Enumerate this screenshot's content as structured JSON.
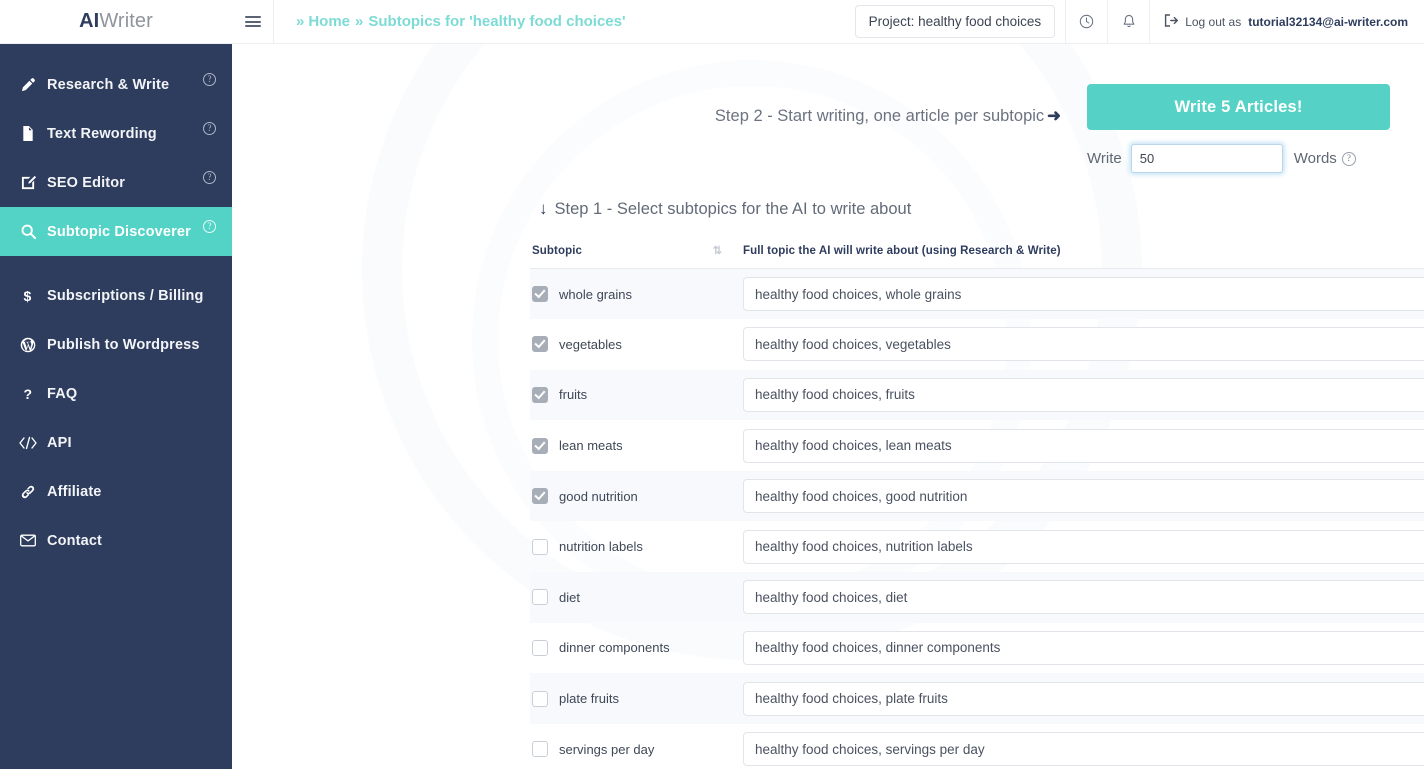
{
  "brand": {
    "bold": "AI",
    "light": "Writer"
  },
  "topbar": {
    "breadcrumb": {
      "chevron": "»",
      "home": "Home",
      "separator": "»",
      "current": "Subtopics for 'healthy food choices'"
    },
    "project_box": "Project: healthy food choices",
    "history_icon": "history-icon",
    "bell_icon": "bell-icon",
    "logout_prefix": "Log out as",
    "logout_email": "tutorial32134@ai-writer.com"
  },
  "sidebar": {
    "items": [
      {
        "label": "Research & Write",
        "icon": "pen-icon",
        "help": "?",
        "active": false
      },
      {
        "label": "Text Rewording",
        "icon": "document-icon",
        "help": "?",
        "active": false
      },
      {
        "label": "SEO Editor",
        "icon": "edit-square-icon",
        "help": "?",
        "active": false
      },
      {
        "label": "Subtopic Discoverer",
        "icon": "search-icon",
        "help": "?",
        "active": true
      },
      {
        "label": "Subscriptions / Billing",
        "icon": "dollar-icon",
        "help": "",
        "active": false
      },
      {
        "label": "Publish to Wordpress",
        "icon": "wordpress-icon",
        "help": "",
        "active": false
      },
      {
        "label": "FAQ",
        "icon": "question-icon",
        "help": "",
        "active": false
      },
      {
        "label": "API",
        "icon": "code-icon",
        "help": "",
        "active": false
      },
      {
        "label": "Affiliate",
        "icon": "link-icon",
        "help": "",
        "active": false
      },
      {
        "label": "Contact",
        "icon": "envelope-icon",
        "help": "",
        "active": false
      }
    ]
  },
  "main": {
    "step2_label": "Step 2 - Start writing, one article per subtopic",
    "step2_arrow": "➜",
    "write_button": "Write 5 Articles!",
    "write_prefix": "Write",
    "words_value": "50",
    "words_placeholder": "",
    "words_suffix": "Words",
    "words_help": "?",
    "step1_arrow": "↓",
    "step1_label": "Step 1 - Select subtopics for the AI to write about",
    "table": {
      "headers": {
        "subtopic": "Subtopic",
        "full_topic": "Full topic the AI will write about (using Research & Write)"
      },
      "rows": [
        {
          "checked": true,
          "subtopic": "whole grains",
          "topic": "healthy food choices, whole grains"
        },
        {
          "checked": true,
          "subtopic": "vegetables",
          "topic": "healthy food choices, vegetables"
        },
        {
          "checked": true,
          "subtopic": "fruits",
          "topic": "healthy food choices, fruits"
        },
        {
          "checked": true,
          "subtopic": "lean meats",
          "topic": "healthy food choices, lean meats"
        },
        {
          "checked": true,
          "subtopic": "good nutrition",
          "topic": "healthy food choices, good nutrition"
        },
        {
          "checked": false,
          "subtopic": "nutrition labels",
          "topic": "healthy food choices, nutrition labels"
        },
        {
          "checked": false,
          "subtopic": "diet",
          "topic": "healthy food choices, diet"
        },
        {
          "checked": false,
          "subtopic": "dinner components",
          "topic": "healthy food choices, dinner components"
        },
        {
          "checked": false,
          "subtopic": "plate fruits",
          "topic": "healthy food choices, plate fruits"
        },
        {
          "checked": false,
          "subtopic": "servings per day",
          "topic": "healthy food choices, servings per day"
        }
      ]
    }
  },
  "colors": {
    "sidebar": "#2e3c5d",
    "accent_teal": "#56d1c5",
    "breadcrumb_teal": "#7ddbd5",
    "row_alt": "#f7f9fc"
  }
}
